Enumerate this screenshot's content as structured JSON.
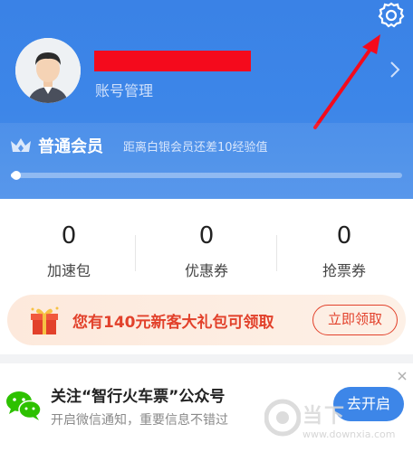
{
  "profile": {
    "account_label": "账号管理",
    "username_redacted": true
  },
  "membership": {
    "level": "普通会员",
    "progress_text": "距离白银会员还差10经验值",
    "progress": 0.02
  },
  "stats": [
    {
      "value": "0",
      "label": "加速包"
    },
    {
      "value": "0",
      "label": "优惠券"
    },
    {
      "value": "0",
      "label": "抢票券"
    }
  ],
  "promo": {
    "text": "您有140元新客大礼包可领取",
    "button": "立即领取"
  },
  "follow": {
    "title": "关注“智行火车票”公众号",
    "subtitle": "开启微信通知，重要信息不错过",
    "button": "去开启"
  },
  "watermark": {
    "brand": "当下",
    "url": "www.downxia.com"
  },
  "colors": {
    "header_blue": "#3a82e6",
    "promo_red": "#e2412b",
    "annotation_arrow": "#f40a1c"
  },
  "icons": {
    "settings": "gear-icon",
    "chevron": "chevron-right-icon",
    "crown": "crown-icon",
    "gift": "gift-icon",
    "wechat": "wechat-icon"
  }
}
